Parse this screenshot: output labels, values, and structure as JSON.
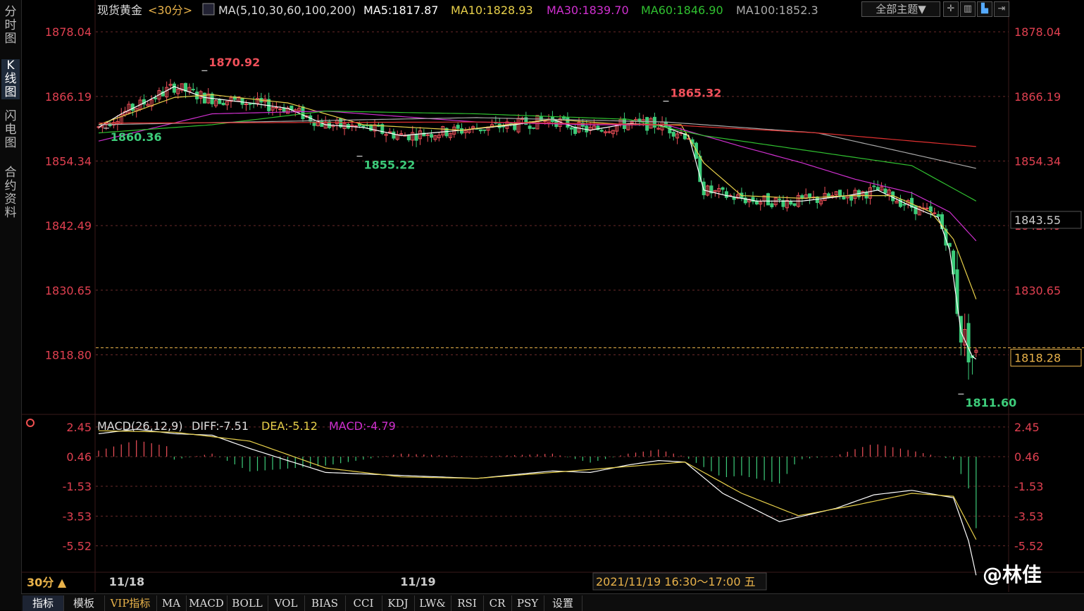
{
  "sidebar": [
    "分时图",
    "K线图",
    "闪电图",
    "合约资料"
  ],
  "header": {
    "symbol": "现货黄金",
    "period_tag": "<30分>",
    "ma_def": "MA(5,10,30,60,100,200)",
    "ma5": "MA5:1817.87",
    "ma10": "MA10:1828.93",
    "ma30": "MA30:1839.70",
    "ma60": "MA60:1846.90",
    "ma100": "MA100:1852.3",
    "theme_button": "全部主题▼"
  },
  "macd_header": {
    "def": "MACD(26,12,9)",
    "diff": "DIFF:-7.51",
    "dea": "DEA:-5.12",
    "macd": "MACD:-4.79"
  },
  "bottom": {
    "period": "30分 ▲",
    "tabs": [
      "指标",
      "模板",
      "VIP指标",
      "MA",
      "MACD",
      "BOLL",
      "VOL",
      "BIAS",
      "CCI",
      "KDJ",
      "LW&",
      "RSI",
      "CR",
      "PSY",
      "设置"
    ]
  },
  "watermark": "@林佳",
  "colors": {
    "up": "#f0505a",
    "down": "#3dcc7a",
    "ma5": "#ffffff",
    "ma10": "#e8d04a",
    "ma30": "#d030d0",
    "ma60": "#30c030",
    "ma100": "#aaaaaa",
    "ma200": "#e03030",
    "axis_label": "#e04050",
    "grid": "#6a2a2a"
  },
  "chart_data": [
    {
      "type": "candlestick",
      "ylim": [
        1808,
        1880
      ],
      "yticks": [
        "1878.04",
        "1866.19",
        "1854.34",
        "1842.49",
        "1830.65",
        "1818.80"
      ],
      "current_price_label": "1818.28",
      "crosshair_price_label": "1843.55",
      "x_labels": [
        "11/18",
        "11/19"
      ],
      "crosshair_time": "2021/11/19 16:30～17:00 五",
      "annotations": [
        {
          "label": "1870.92",
          "value": 1870.92,
          "kind": "high"
        },
        {
          "label": "1860.36",
          "value": 1860.36,
          "kind": "low"
        },
        {
          "label": "1855.22",
          "value": 1855.22,
          "kind": "low"
        },
        {
          "label": "1865.32",
          "value": 1865.32,
          "kind": "high"
        },
        {
          "label": "1811.60",
          "value": 1811.6,
          "kind": "low"
        }
      ],
      "ma_anchors": {
        "ma5": [
          [
            0,
            1860.5
          ],
          [
            6,
            1863
          ],
          [
            12,
            1865
          ],
          [
            20,
            1868
          ],
          [
            28,
            1866
          ],
          [
            40,
            1865
          ],
          [
            50,
            1864
          ],
          [
            60,
            1861
          ],
          [
            70,
            1860.5
          ],
          [
            80,
            1859
          ],
          [
            96,
            1860
          ],
          [
            110,
            1861
          ],
          [
            120,
            1862
          ],
          [
            126,
            1860.5
          ],
          [
            130,
            1860
          ],
          [
            140,
            1861.2
          ],
          [
            148,
            1861
          ],
          [
            156,
            1859
          ],
          [
            160,
            1849
          ],
          [
            166,
            1848
          ],
          [
            174,
            1847
          ],
          [
            186,
            1847
          ],
          [
            198,
            1848
          ],
          [
            206,
            1849
          ],
          [
            215,
            1846
          ],
          [
            222,
            1844
          ],
          [
            225,
            1838
          ],
          [
            228,
            1823
          ],
          [
            231,
            1818.5
          ],
          [
            232,
            1818
          ]
        ],
        "ma10": [
          [
            0,
            1861
          ],
          [
            20,
            1866
          ],
          [
            30,
            1866.5
          ],
          [
            50,
            1865
          ],
          [
            70,
            1861
          ],
          [
            96,
            1860
          ],
          [
            120,
            1862
          ],
          [
            140,
            1861
          ],
          [
            154,
            1861
          ],
          [
            160,
            1854
          ],
          [
            170,
            1848
          ],
          [
            186,
            1847.5
          ],
          [
            198,
            1848
          ],
          [
            210,
            1848
          ],
          [
            220,
            1845
          ],
          [
            226,
            1840
          ],
          [
            232,
            1829
          ]
        ],
        "ma30": [
          [
            0,
            1858
          ],
          [
            30,
            1863
          ],
          [
            60,
            1863.5
          ],
          [
            100,
            1861.5
          ],
          [
            130,
            1861
          ],
          [
            150,
            1861
          ],
          [
            170,
            1857
          ],
          [
            186,
            1854
          ],
          [
            200,
            1851
          ],
          [
            215,
            1848.5
          ],
          [
            225,
            1845
          ],
          [
            232,
            1839.7
          ]
        ],
        "ma60": [
          [
            0,
            1859.5
          ],
          [
            30,
            1861
          ],
          [
            60,
            1863.5
          ],
          [
            100,
            1863
          ],
          [
            140,
            1862
          ],
          [
            160,
            1859
          ],
          [
            190,
            1856
          ],
          [
            215,
            1853.5
          ],
          [
            232,
            1847
          ]
        ],
        "ma100": [
          [
            0,
            1861
          ],
          [
            100,
            1862.3
          ],
          [
            150,
            1861.5
          ],
          [
            190,
            1859.5
          ],
          [
            232,
            1853
          ]
        ],
        "ma200": [
          [
            0,
            1861.3
          ],
          [
            100,
            1861.5
          ],
          [
            150,
            1861
          ],
          [
            190,
            1859.5
          ],
          [
            232,
            1857
          ]
        ]
      }
    },
    {
      "type": "macd",
      "ylim": [
        -7.2,
        3.2
      ],
      "yticks": [
        "2.45",
        "0.46",
        "-1.53",
        "-3.53",
        "-5.52"
      ],
      "diff_anchors": [
        [
          0,
          2.0
        ],
        [
          10,
          2.3
        ],
        [
          20,
          2.0
        ],
        [
          30,
          1.9
        ],
        [
          40,
          1.0
        ],
        [
          60,
          -0.6
        ],
        [
          80,
          -0.8
        ],
        [
          100,
          -1.0
        ],
        [
          120,
          -0.5
        ],
        [
          130,
          -0.6
        ],
        [
          140,
          -0.1
        ],
        [
          148,
          0.2
        ],
        [
          155,
          0.1
        ],
        [
          165,
          -2.0
        ],
        [
          180,
          -3.9
        ],
        [
          195,
          -3.0
        ],
        [
          205,
          -2.1
        ],
        [
          215,
          -1.8
        ],
        [
          226,
          -2.3
        ],
        [
          230,
          -5.2
        ],
        [
          232,
          -7.5
        ]
      ],
      "dea_anchors": [
        [
          0,
          2.2
        ],
        [
          20,
          2.1
        ],
        [
          40,
          1.5
        ],
        [
          60,
          -0.3
        ],
        [
          80,
          -0.9
        ],
        [
          100,
          -1.0
        ],
        [
          120,
          -0.6
        ],
        [
          140,
          -0.2
        ],
        [
          155,
          0.1
        ],
        [
          170,
          -2.0
        ],
        [
          185,
          -3.5
        ],
        [
          200,
          -2.8
        ],
        [
          215,
          -2.0
        ],
        [
          226,
          -2.2
        ],
        [
          232,
          -5.1
        ]
      ]
    }
  ]
}
